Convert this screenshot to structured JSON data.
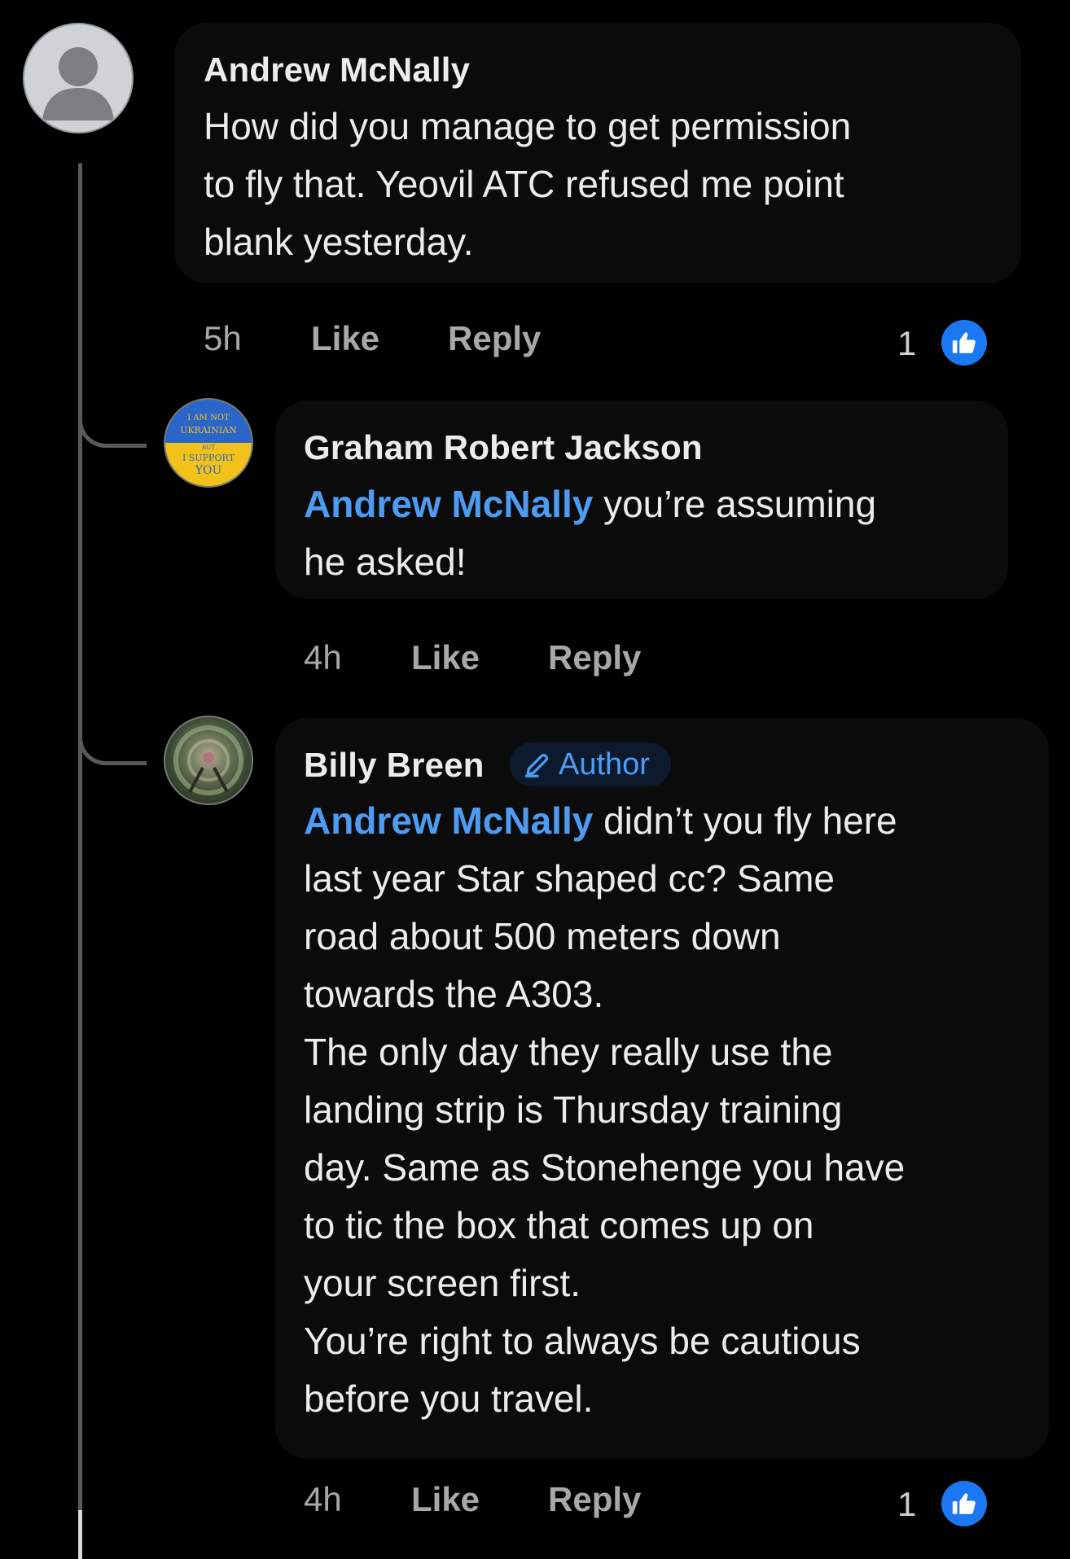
{
  "comments": [
    {
      "author": "Andrew McNally",
      "lines": [
        "How did you manage to get permission",
        "to fly that. Yeovil ATC refused me point",
        "blank yesterday."
      ],
      "time": "5h",
      "like_label": "Like",
      "reply_label": "Reply",
      "reaction_count": "1"
    }
  ],
  "replies": [
    {
      "author": "Graham Robert Jackson",
      "avatar_text": [
        "I AM NOT",
        "UKRAINIAN",
        "BUT",
        "I SUPPORT",
        "YOU"
      ],
      "mention": "Andrew McNally",
      "first_line_rest": " you’re assuming",
      "lines": [
        "he asked!"
      ],
      "time": "4h",
      "like_label": "Like",
      "reply_label": "Reply"
    },
    {
      "author": "Billy Breen",
      "badge": "Author",
      "mention": "Andrew McNally",
      "first_line_rest": " didn’t you fly here",
      "lines": [
        "last year Star shaped cc? Same",
        "road about 500 meters down",
        "towards the A303.",
        "The only day they really use the",
        "landing strip is Thursday training",
        "day. Same as Stonehenge you have",
        "to tic the box that comes up on",
        "your screen first.",
        "You’re right to always be cautious",
        "before you travel."
      ],
      "time": "4h",
      "like_label": "Like",
      "reply_label": "Reply",
      "reaction_count": "1"
    }
  ],
  "colors": {
    "background": "#000000",
    "mention": "#4d9cf3",
    "like_badge": "#1b78f2",
    "muted_text": "#a8a8a8"
  },
  "icons": {
    "default_avatar": "user-silhouette-icon",
    "reaction": "thumbs-up-icon",
    "badge": "pencil-icon"
  }
}
